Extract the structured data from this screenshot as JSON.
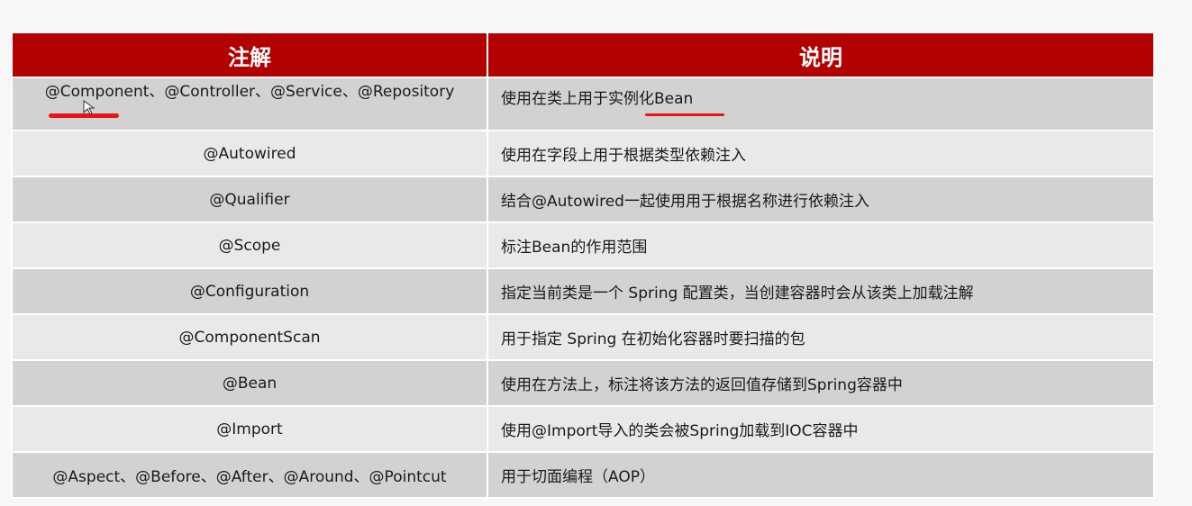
{
  "table": {
    "header": {
      "annotation": "注解",
      "description": "说明"
    },
    "rows": [
      {
        "annotation": "@Component、@Controller、@Service、@Repository",
        "description": "使用在类上用于实例化Bean"
      },
      {
        "annotation": "@Autowired",
        "description": "使用在字段上用于根据类型依赖注入"
      },
      {
        "annotation": "@Qualifier",
        "description": "结合@Autowired一起使用用于根据名称进行依赖注入"
      },
      {
        "annotation": "@Scope",
        "description": "标注Bean的作用范围"
      },
      {
        "annotation": "@Configuration",
        "description": "指定当前类是一个 Spring 配置类，当创建容器时会从该类上加载注解"
      },
      {
        "annotation": "@ComponentScan",
        "description": "用于指定 Spring  在初始化容器时要扫描的包"
      },
      {
        "annotation": "@Bean",
        "description": "使用在方法上，标注将该方法的返回值存储到Spring容器中"
      },
      {
        "annotation": "@Import",
        "description": "使用@Import导入的类会被Spring加载到IOC容器中"
      },
      {
        "annotation": "@Aspect、@Before、@After、@Around、@Pointcut",
        "description": "用于切面编程（AOP）"
      }
    ]
  },
  "colors": {
    "header_bg": "#b30000",
    "row_dark": "#d2d2d2",
    "row_light": "#e9e9e9",
    "highlight_mark": "#e8141b"
  },
  "icons": {
    "cursor": "pen-cursor-icon"
  }
}
